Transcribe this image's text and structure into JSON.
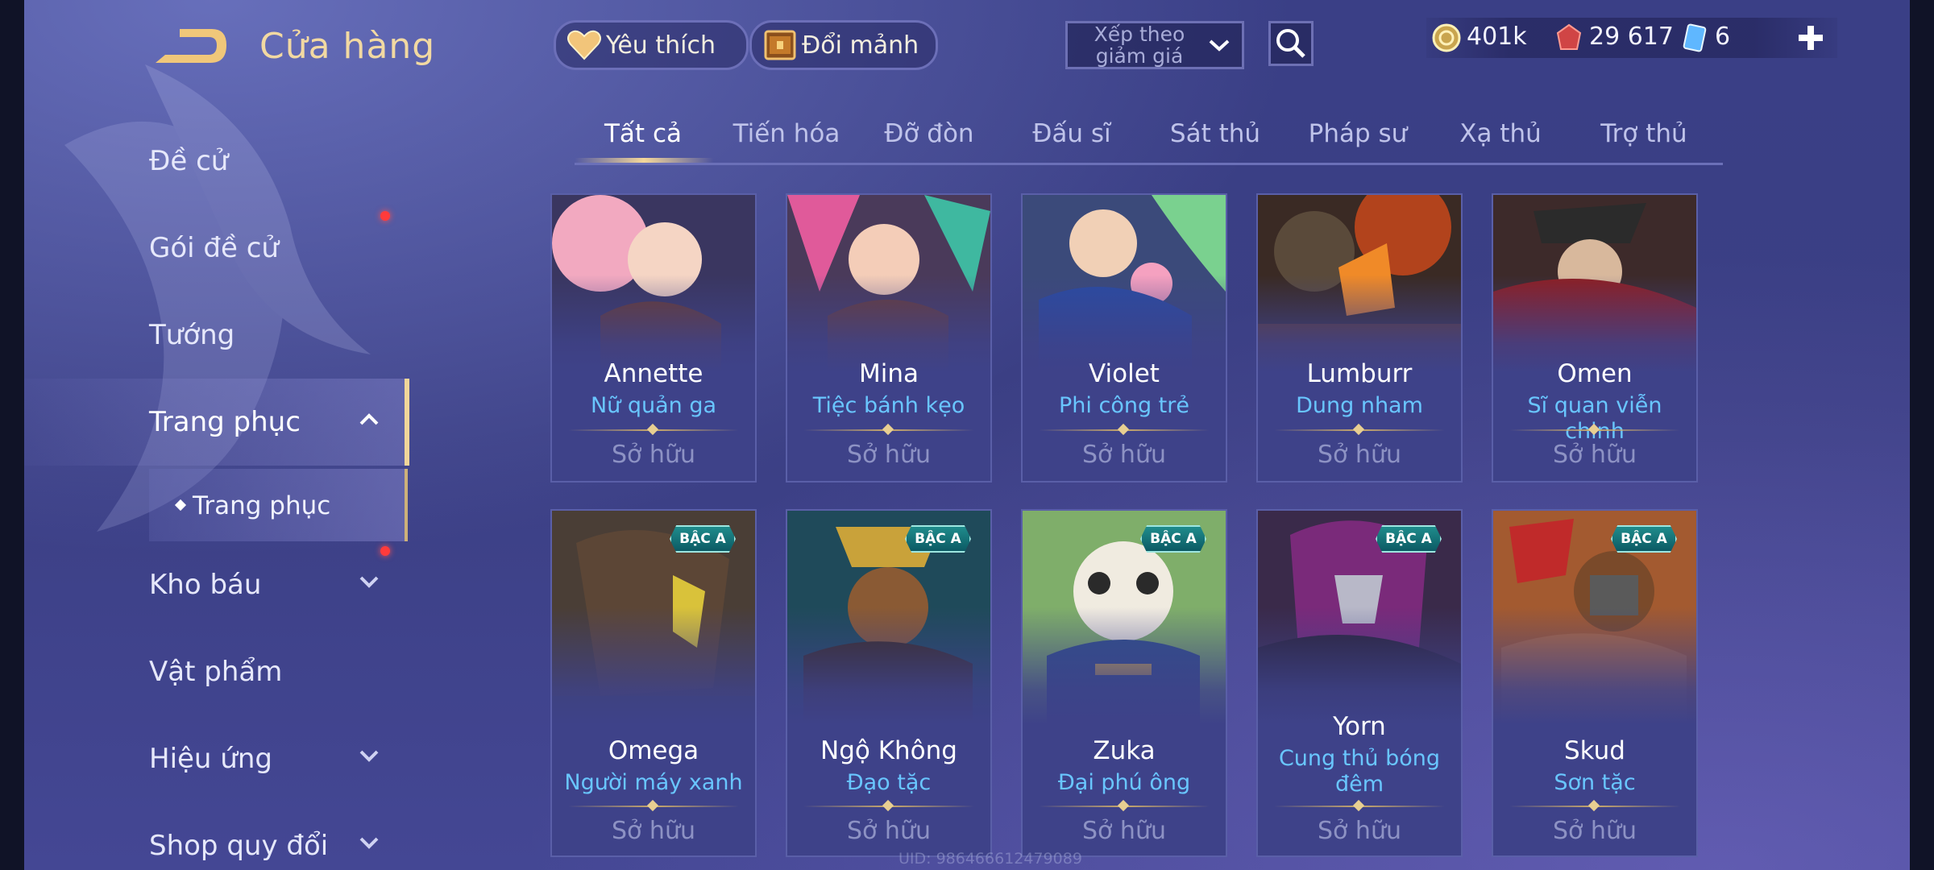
{
  "header": {
    "title": "Cửa hàng"
  },
  "sidebar": {
    "items": [
      {
        "label": "Đề cử",
        "has_dot": false,
        "chevron": ""
      },
      {
        "label": "Gói đề cử",
        "has_dot": true,
        "chevron": ""
      },
      {
        "label": "Tướng",
        "has_dot": false,
        "chevron": ""
      },
      {
        "label": "Trang phục",
        "has_dot": false,
        "chevron": "up",
        "active": true
      },
      {
        "label": "Kho báu",
        "has_dot": true,
        "chevron": "down"
      },
      {
        "label": "Vật phẩm",
        "has_dot": false,
        "chevron": ""
      },
      {
        "label": "Hiệu ứng",
        "has_dot": false,
        "chevron": "down"
      },
      {
        "label": "Shop quy đổi",
        "has_dot": false,
        "chevron": "down"
      }
    ],
    "sub_item": {
      "label": "Trang phục"
    }
  },
  "toolbar": {
    "favorite_label": "Yêu thích",
    "shard_label": "Đổi mảnh",
    "sort": {
      "value": "Xếp theo giảm giá"
    }
  },
  "currency": {
    "gold": "401k",
    "vouchers": "29 617",
    "cards": "6"
  },
  "tabs": [
    {
      "label": "Tất cả",
      "active": true
    },
    {
      "label": "Tiến hóa"
    },
    {
      "label": "Đỡ đòn"
    },
    {
      "label": "Đấu sĩ"
    },
    {
      "label": "Sát thủ"
    },
    {
      "label": "Pháp sư"
    },
    {
      "label": "Xạ thủ"
    },
    {
      "label": "Trợ thủ"
    }
  ],
  "skins": [
    {
      "hero": "Annette",
      "skin": "Nữ quản ga",
      "status": "Sở hữu",
      "badge": ""
    },
    {
      "hero": "Mina",
      "skin": "Tiệc bánh kẹo",
      "status": "Sở hữu",
      "badge": ""
    },
    {
      "hero": "Violet",
      "skin": "Phi công trẻ",
      "status": "Sở hữu",
      "badge": ""
    },
    {
      "hero": "Lumburr",
      "skin": "Dung nham",
      "status": "Sở hữu",
      "badge": ""
    },
    {
      "hero": "Omen",
      "skin": "Sĩ quan viễn chinh",
      "status": "Sở hữu",
      "badge": ""
    },
    {
      "hero": "Omega",
      "skin": "Người máy xanh",
      "status": "Sở hữu",
      "badge": "BẬC A"
    },
    {
      "hero": "Ngộ Không",
      "skin": "Đạo tặc",
      "status": "Sở hữu",
      "badge": "BẬC A"
    },
    {
      "hero": "Zuka",
      "skin": "Đại phú ông",
      "status": "Sở hữu",
      "badge": "BẬC A"
    },
    {
      "hero": "Yorn",
      "skin": "Cung thủ bóng đêm",
      "status": "Sở hữu",
      "badge": "BẬC A"
    },
    {
      "hero": "Skud",
      "skin": "Sơn tặc",
      "status": "Sở hữu",
      "badge": "BẬC A"
    }
  ],
  "footer": {
    "uid": "UID: 986466612479089"
  },
  "colors": {
    "accent_gold": "#f1d69a",
    "skin_name": "#69c6ff",
    "badge": "#1f8c8c",
    "notification": "#ff3b3b"
  }
}
